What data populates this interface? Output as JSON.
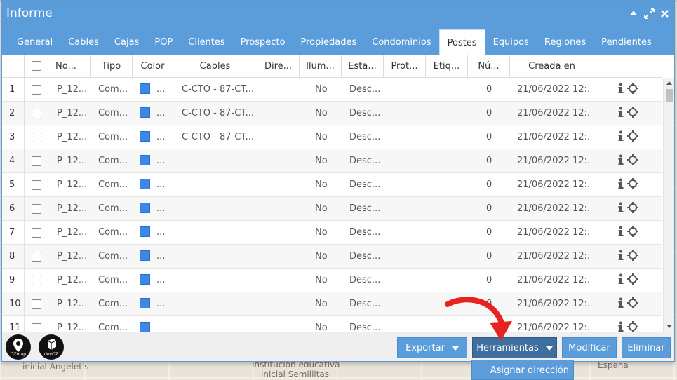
{
  "map": {
    "labels": [
      {
        "text": "inicial Angelet's",
        "cls": "l1"
      },
      {
        "text": "Institución educativa",
        "cls": "l2"
      },
      {
        "text": "inicial Semillitas",
        "cls": "l3"
      },
      {
        "text": "España",
        "cls": "l4"
      }
    ]
  },
  "window": {
    "title": "Informe",
    "icons": [
      "collapse-up-icon",
      "expand-icon",
      "close-icon"
    ]
  },
  "tabs": [
    {
      "label": "General",
      "active": false
    },
    {
      "label": "Cables",
      "active": false
    },
    {
      "label": "Cajas",
      "active": false
    },
    {
      "label": "POP",
      "active": false
    },
    {
      "label": "Clientes",
      "active": false
    },
    {
      "label": "Prospecto",
      "active": false
    },
    {
      "label": "Propiedades",
      "active": false
    },
    {
      "label": "Condominios",
      "active": false
    },
    {
      "label": "Postes",
      "active": true
    },
    {
      "label": "Equipos",
      "active": false
    },
    {
      "label": "Regiones",
      "active": false
    },
    {
      "label": "Pendientes",
      "active": false
    }
  ],
  "table": {
    "headers": [
      "No...",
      "Tipo",
      "Color",
      "Cables",
      "Dire...",
      "Ilum...",
      "Esta...",
      "Prot...",
      "Etiq...",
      "Nú...",
      "Creada en"
    ],
    "rows": [
      {
        "n": "1",
        "no": "P_12...",
        "tipo": "Com...",
        "color_dots": "...",
        "cables": "C-CTO - 87-CT...",
        "ilum": "No",
        "estado": "Desc...",
        "num": "0",
        "creada": "21/06/2022 12:..."
      },
      {
        "n": "2",
        "no": "P_12...",
        "tipo": "Com...",
        "color_dots": "...",
        "cables": "C-CTO - 87-CT...",
        "ilum": "No",
        "estado": "Desc...",
        "num": "0",
        "creada": "21/06/2022 12:..."
      },
      {
        "n": "3",
        "no": "P_12...",
        "tipo": "Com...",
        "color_dots": "...",
        "cables": "C-CTO - 87-CT...",
        "ilum": "No",
        "estado": "Desc...",
        "num": "0",
        "creada": "21/06/2022 12:..."
      },
      {
        "n": "4",
        "no": "P_12...",
        "tipo": "Com...",
        "color_dots": "...",
        "cables": "",
        "ilum": "No",
        "estado": "Desc...",
        "num": "0",
        "creada": "21/06/2022 12:..."
      },
      {
        "n": "5",
        "no": "P_12...",
        "tipo": "Com...",
        "color_dots": "...",
        "cables": "",
        "ilum": "No",
        "estado": "Desc...",
        "num": "0",
        "creada": "21/06/2022 12:..."
      },
      {
        "n": "6",
        "no": "P_12...",
        "tipo": "Com...",
        "color_dots": "...",
        "cables": "",
        "ilum": "No",
        "estado": "Desc...",
        "num": "0",
        "creada": "21/06/2022 12:..."
      },
      {
        "n": "7",
        "no": "P_12...",
        "tipo": "Com...",
        "color_dots": "...",
        "cables": "",
        "ilum": "No",
        "estado": "Desc...",
        "num": "0",
        "creada": "21/06/2022 12:..."
      },
      {
        "n": "8",
        "no": "P_12...",
        "tipo": "Com...",
        "color_dots": "...",
        "cables": "",
        "ilum": "No",
        "estado": "Desc...",
        "num": "0",
        "creada": "21/06/2022 12:..."
      },
      {
        "n": "9",
        "no": "P_12...",
        "tipo": "Com...",
        "color_dots": "...",
        "cables": "",
        "ilum": "No",
        "estado": "Desc...",
        "num": "0",
        "creada": "21/06/2022 12:..."
      },
      {
        "n": "10",
        "no": "P_12...",
        "tipo": "Com...",
        "color_dots": "...",
        "cables": "",
        "ilum": "No",
        "estado": "Desc...",
        "num": "0",
        "creada": "21/06/2022 12:..."
      },
      {
        "n": "11",
        "no": "P_12...",
        "tipo": "Com...",
        "color_dots": "",
        "cables": "",
        "ilum": "No",
        "estado": "Desc...",
        "num": "",
        "creada": "21/06/2022 12:..."
      }
    ],
    "swatch_color": "#3d87e8"
  },
  "footer": {
    "logos": [
      {
        "text": "OZmap",
        "icon": "map-pin-icon"
      },
      {
        "text": "devOZ",
        "icon": "cube-icon"
      }
    ],
    "buttons": {
      "exportar": "Exportar",
      "herramientas": "Herramientas",
      "modificar": "Modificar",
      "eliminar": "Eliminar"
    },
    "dropdown_item": "Asignar dirección"
  },
  "colors": {
    "header_blue": "#5b9ddb",
    "button_dark": "#3f6f9f",
    "arrow_red": "#e8231f"
  }
}
